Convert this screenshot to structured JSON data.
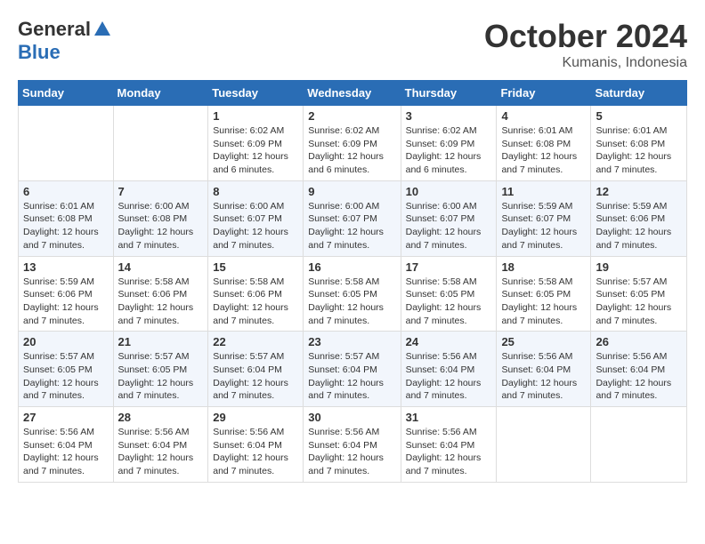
{
  "logo": {
    "general": "General",
    "blue": "Blue"
  },
  "title": {
    "month": "October 2024",
    "location": "Kumanis, Indonesia"
  },
  "calendar": {
    "headers": [
      "Sunday",
      "Monday",
      "Tuesday",
      "Wednesday",
      "Thursday",
      "Friday",
      "Saturday"
    ],
    "weeks": [
      [
        {
          "day": "",
          "info": ""
        },
        {
          "day": "",
          "info": ""
        },
        {
          "day": "1",
          "info": "Sunrise: 6:02 AM\nSunset: 6:09 PM\nDaylight: 12 hours and 6 minutes."
        },
        {
          "day": "2",
          "info": "Sunrise: 6:02 AM\nSunset: 6:09 PM\nDaylight: 12 hours and 6 minutes."
        },
        {
          "day": "3",
          "info": "Sunrise: 6:02 AM\nSunset: 6:09 PM\nDaylight: 12 hours and 6 minutes."
        },
        {
          "day": "4",
          "info": "Sunrise: 6:01 AM\nSunset: 6:08 PM\nDaylight: 12 hours and 7 minutes."
        },
        {
          "day": "5",
          "info": "Sunrise: 6:01 AM\nSunset: 6:08 PM\nDaylight: 12 hours and 7 minutes."
        }
      ],
      [
        {
          "day": "6",
          "info": "Sunrise: 6:01 AM\nSunset: 6:08 PM\nDaylight: 12 hours and 7 minutes."
        },
        {
          "day": "7",
          "info": "Sunrise: 6:00 AM\nSunset: 6:08 PM\nDaylight: 12 hours and 7 minutes."
        },
        {
          "day": "8",
          "info": "Sunrise: 6:00 AM\nSunset: 6:07 PM\nDaylight: 12 hours and 7 minutes."
        },
        {
          "day": "9",
          "info": "Sunrise: 6:00 AM\nSunset: 6:07 PM\nDaylight: 12 hours and 7 minutes."
        },
        {
          "day": "10",
          "info": "Sunrise: 6:00 AM\nSunset: 6:07 PM\nDaylight: 12 hours and 7 minutes."
        },
        {
          "day": "11",
          "info": "Sunrise: 5:59 AM\nSunset: 6:07 PM\nDaylight: 12 hours and 7 minutes."
        },
        {
          "day": "12",
          "info": "Sunrise: 5:59 AM\nSunset: 6:06 PM\nDaylight: 12 hours and 7 minutes."
        }
      ],
      [
        {
          "day": "13",
          "info": "Sunrise: 5:59 AM\nSunset: 6:06 PM\nDaylight: 12 hours and 7 minutes."
        },
        {
          "day": "14",
          "info": "Sunrise: 5:58 AM\nSunset: 6:06 PM\nDaylight: 12 hours and 7 minutes."
        },
        {
          "day": "15",
          "info": "Sunrise: 5:58 AM\nSunset: 6:06 PM\nDaylight: 12 hours and 7 minutes."
        },
        {
          "day": "16",
          "info": "Sunrise: 5:58 AM\nSunset: 6:05 PM\nDaylight: 12 hours and 7 minutes."
        },
        {
          "day": "17",
          "info": "Sunrise: 5:58 AM\nSunset: 6:05 PM\nDaylight: 12 hours and 7 minutes."
        },
        {
          "day": "18",
          "info": "Sunrise: 5:58 AM\nSunset: 6:05 PM\nDaylight: 12 hours and 7 minutes."
        },
        {
          "day": "19",
          "info": "Sunrise: 5:57 AM\nSunset: 6:05 PM\nDaylight: 12 hours and 7 minutes."
        }
      ],
      [
        {
          "day": "20",
          "info": "Sunrise: 5:57 AM\nSunset: 6:05 PM\nDaylight: 12 hours and 7 minutes."
        },
        {
          "day": "21",
          "info": "Sunrise: 5:57 AM\nSunset: 6:05 PM\nDaylight: 12 hours and 7 minutes."
        },
        {
          "day": "22",
          "info": "Sunrise: 5:57 AM\nSunset: 6:04 PM\nDaylight: 12 hours and 7 minutes."
        },
        {
          "day": "23",
          "info": "Sunrise: 5:57 AM\nSunset: 6:04 PM\nDaylight: 12 hours and 7 minutes."
        },
        {
          "day": "24",
          "info": "Sunrise: 5:56 AM\nSunset: 6:04 PM\nDaylight: 12 hours and 7 minutes."
        },
        {
          "day": "25",
          "info": "Sunrise: 5:56 AM\nSunset: 6:04 PM\nDaylight: 12 hours and 7 minutes."
        },
        {
          "day": "26",
          "info": "Sunrise: 5:56 AM\nSunset: 6:04 PM\nDaylight: 12 hours and 7 minutes."
        }
      ],
      [
        {
          "day": "27",
          "info": "Sunrise: 5:56 AM\nSunset: 6:04 PM\nDaylight: 12 hours and 7 minutes."
        },
        {
          "day": "28",
          "info": "Sunrise: 5:56 AM\nSunset: 6:04 PM\nDaylight: 12 hours and 7 minutes."
        },
        {
          "day": "29",
          "info": "Sunrise: 5:56 AM\nSunset: 6:04 PM\nDaylight: 12 hours and 7 minutes."
        },
        {
          "day": "30",
          "info": "Sunrise: 5:56 AM\nSunset: 6:04 PM\nDaylight: 12 hours and 7 minutes."
        },
        {
          "day": "31",
          "info": "Sunrise: 5:56 AM\nSunset: 6:04 PM\nDaylight: 12 hours and 7 minutes."
        },
        {
          "day": "",
          "info": ""
        },
        {
          "day": "",
          "info": ""
        }
      ]
    ]
  }
}
